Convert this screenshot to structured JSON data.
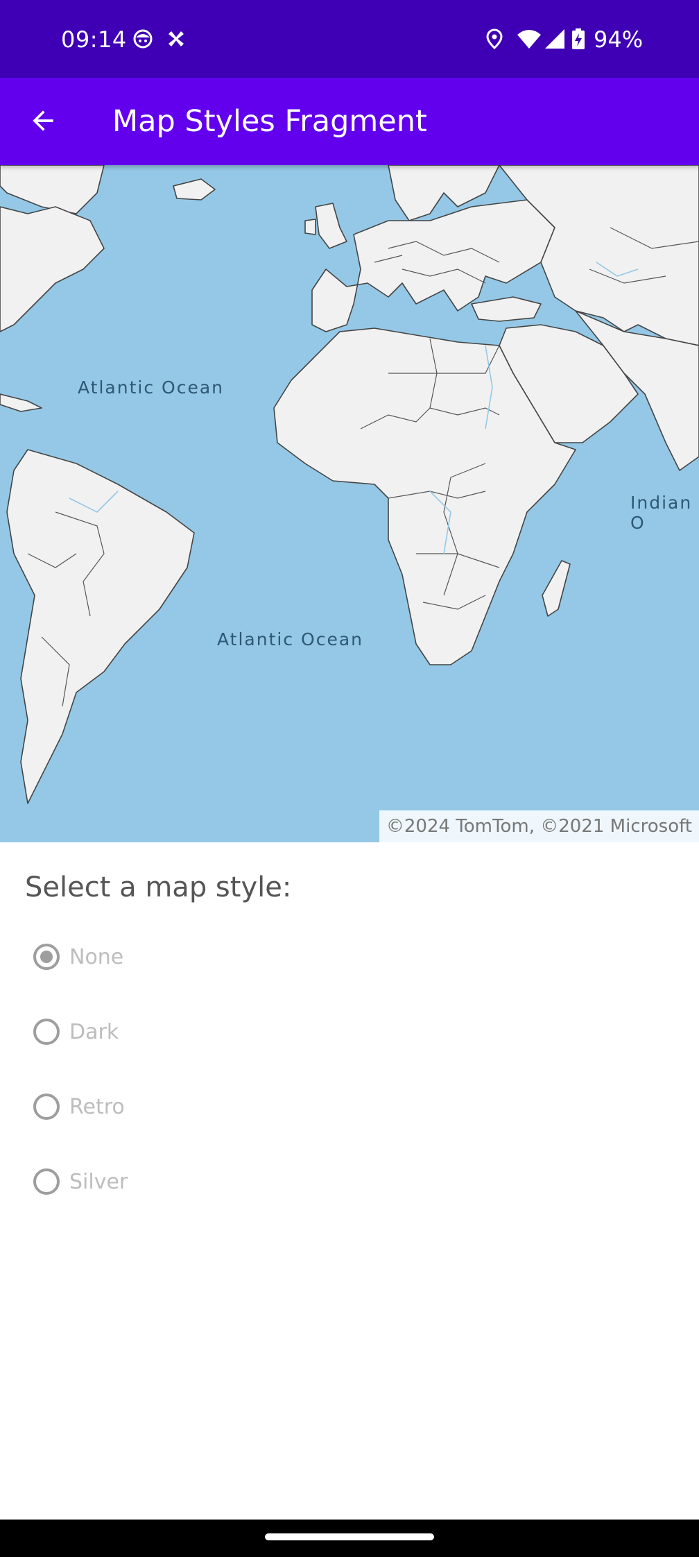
{
  "status_bar": {
    "time": "09:14",
    "battery": "94%",
    "icons": [
      "face-icon",
      "cast-icon",
      "location-icon",
      "wifi-icon",
      "signal-icon",
      "battery-charging-icon"
    ]
  },
  "app_bar": {
    "title": "Map Styles Fragment",
    "back_icon": "arrow-back-icon"
  },
  "map": {
    "labels": {
      "atlantic_north": "Atlantic Ocean",
      "atlantic_south": "Atlantic Ocean",
      "indian": "Indian O"
    },
    "attribution": "©2024 TomTom, ©2021 Microsoft",
    "colors": {
      "water": "#94C8E6",
      "land": "#F1F1F1",
      "border": "#444444"
    }
  },
  "style_picker": {
    "prompt": "Select a map style:",
    "options": [
      {
        "label": "None",
        "checked": true
      },
      {
        "label": "Dark",
        "checked": false
      },
      {
        "label": "Retro",
        "checked": false
      },
      {
        "label": "Silver",
        "checked": false
      }
    ]
  },
  "theme": {
    "status_bar": "#3F00B5",
    "app_bar": "#6200EE"
  }
}
